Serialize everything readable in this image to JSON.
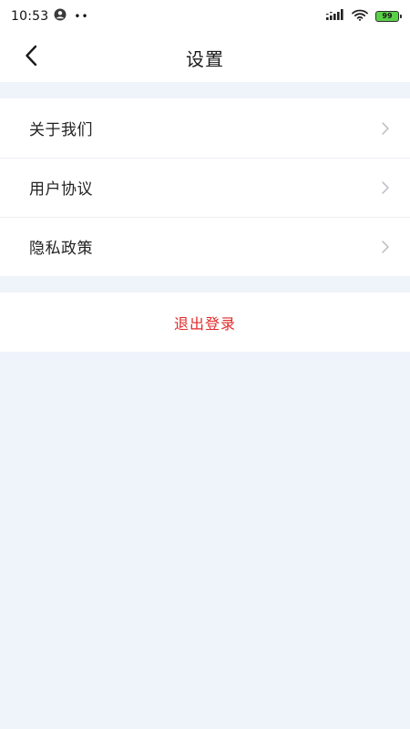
{
  "status_bar": {
    "time": "10:53",
    "dots": "••",
    "battery": "99",
    "icons": [
      "user-circle-icon",
      "signal-icon",
      "wifi-icon",
      "battery-icon"
    ]
  },
  "nav": {
    "title": "设置",
    "back_icon": "chevron-left-icon"
  },
  "menu": {
    "items": [
      {
        "label": "关于我们",
        "icon": "chevron-right-icon"
      },
      {
        "label": "用户协议",
        "icon": "chevron-right-icon"
      },
      {
        "label": "隐私政策",
        "icon": "chevron-right-icon"
      }
    ]
  },
  "logout": {
    "label": "退出登录",
    "color": "#e02b2b"
  },
  "colors": {
    "background": "#eff3fa",
    "surface": "#ffffff",
    "danger": "#e02b2b",
    "battery": "#59d147"
  }
}
